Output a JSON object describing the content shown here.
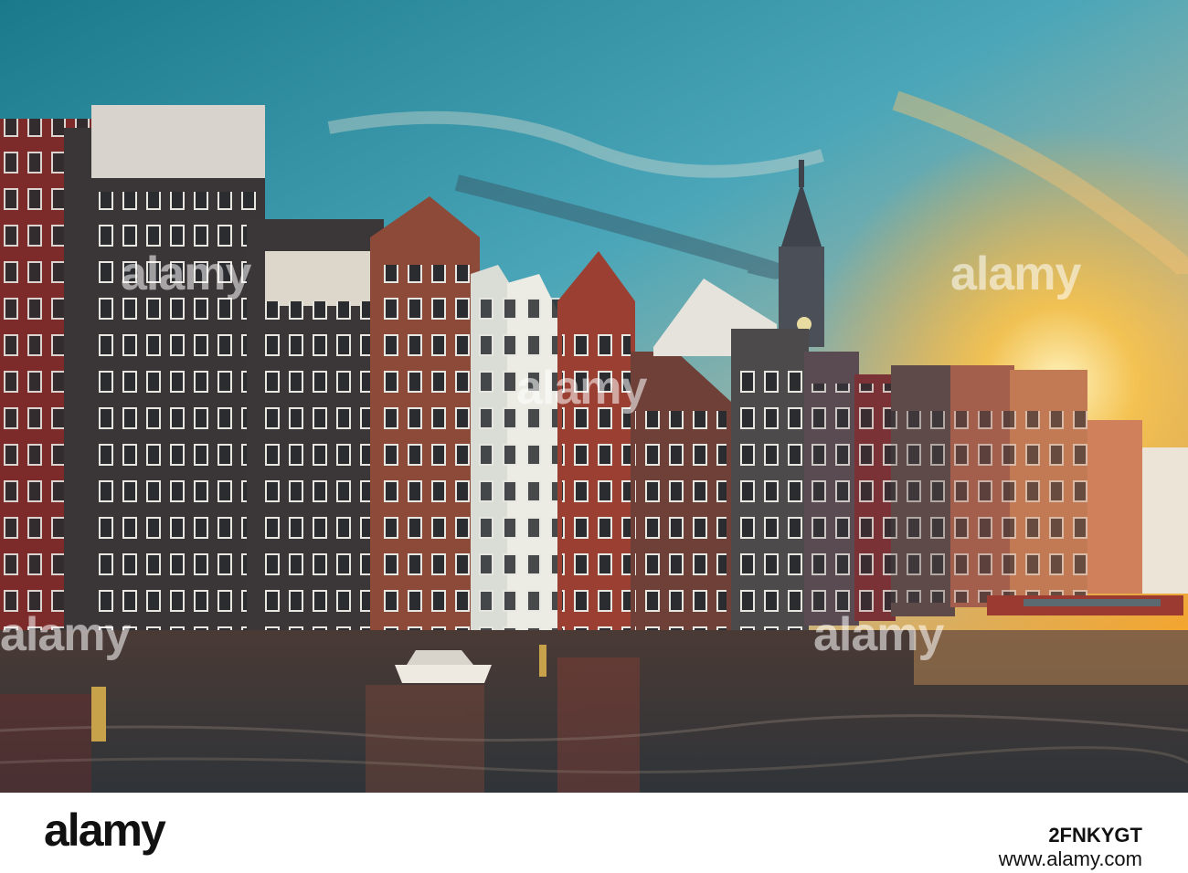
{
  "watermark": {
    "text": "alamy"
  },
  "footer": {
    "logo": "alamy",
    "image_id": "2FNKYGT",
    "url": "www.alamy.com"
  },
  "colors": {
    "sky_top": "#1f7f8f",
    "sky_horizon": "#f6b030",
    "water": "#3a3f44",
    "brick": "#8a3b2c",
    "dark_facade": "#3c3a3a"
  },
  "scene": {
    "subject": "canal-houses",
    "elements": [
      "church-tower",
      "moored-boat",
      "canal-water",
      "sunset-sky"
    ]
  }
}
